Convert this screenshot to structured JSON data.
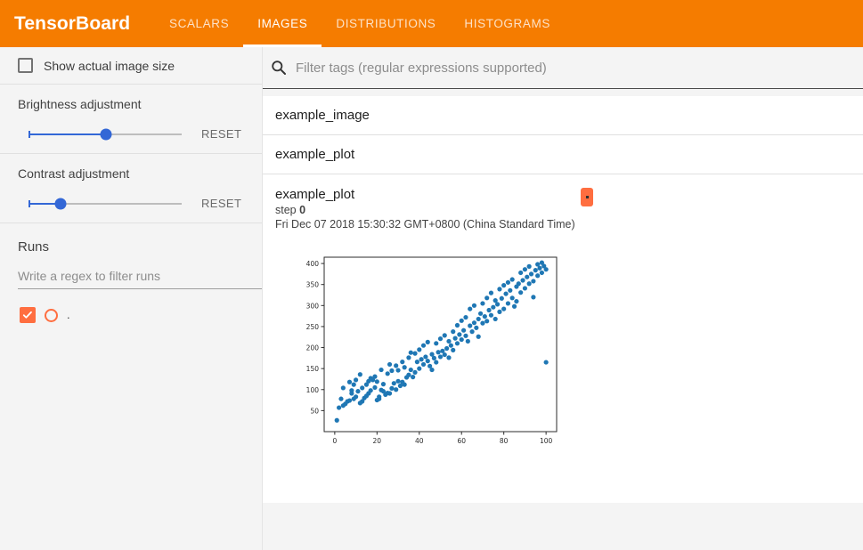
{
  "header": {
    "brand": "TensorBoard",
    "tabs": [
      {
        "label": "SCALARS",
        "active": false
      },
      {
        "label": "IMAGES",
        "active": true
      },
      {
        "label": "DISTRIBUTIONS",
        "active": false
      },
      {
        "label": "HISTOGRAMS",
        "active": false
      }
    ]
  },
  "sidebar": {
    "show_actual_size": {
      "label": "Show actual image size",
      "checked": false
    },
    "brightness": {
      "title": "Brightness adjustment",
      "reset_label": "RESET",
      "value_pct": 50
    },
    "contrast": {
      "title": "Contrast adjustment",
      "reset_label": "RESET",
      "value_pct": 20
    },
    "runs": {
      "title": "Runs",
      "filter_placeholder": "Write a regex to filter runs",
      "filter_value": "",
      "items": [
        {
          "name": ".",
          "selected": true,
          "color": "#ff6e40"
        }
      ]
    }
  },
  "main": {
    "search": {
      "placeholder": "Filter tags (regular expressions supported)",
      "value": "",
      "icon": "search-icon"
    },
    "tags": [
      {
        "label": "example_image"
      },
      {
        "label": "example_plot"
      }
    ],
    "card": {
      "tag": "example_plot",
      "step_label": "step",
      "step_value": "0",
      "timestamp": "Fri Dec 07 2018 15:30:32 GMT+0800 (China Standard Time)",
      "run_badge_name": "."
    }
  },
  "colors": {
    "brand_orange": "#f57c00",
    "run_orange": "#ff6e40",
    "slider_blue": "#3367d6",
    "scatter_blue": "#1f77b4"
  },
  "chart_data": {
    "type": "scatter",
    "title": "",
    "xlabel": "",
    "ylabel": "",
    "xlim": [
      -5,
      105
    ],
    "ylim": [
      0,
      415
    ],
    "xticks": [
      0,
      20,
      40,
      60,
      80,
      100
    ],
    "yticks": [
      50,
      100,
      150,
      200,
      250,
      300,
      350,
      400
    ],
    "grid": false,
    "legend": "none",
    "marker_color": "#1f77b4",
    "marker_size": 5,
    "series": [
      {
        "name": "example_plot",
        "points": [
          [
            1,
            27
          ],
          [
            2,
            57
          ],
          [
            3,
            78
          ],
          [
            4,
            62
          ],
          [
            4,
            104
          ],
          [
            5,
            66
          ],
          [
            6,
            72
          ],
          [
            7,
            74
          ],
          [
            7,
            118
          ],
          [
            8,
            91
          ],
          [
            8,
            98
          ],
          [
            9,
            112
          ],
          [
            9,
            78
          ],
          [
            10,
            83
          ],
          [
            10,
            123
          ],
          [
            11,
            96
          ],
          [
            12,
            68
          ],
          [
            12,
            136
          ],
          [
            13,
            72
          ],
          [
            13,
            104
          ],
          [
            14,
            80
          ],
          [
            15,
            85
          ],
          [
            15,
            112
          ],
          [
            16,
            120
          ],
          [
            16,
            91
          ],
          [
            17,
            127
          ],
          [
            17,
            98
          ],
          [
            18,
            123
          ],
          [
            19,
            105
          ],
          [
            19,
            131
          ],
          [
            20,
            75
          ],
          [
            20,
            119
          ],
          [
            21,
            78
          ],
          [
            21,
            83
          ],
          [
            22,
            99
          ],
          [
            22,
            147
          ],
          [
            23,
            96
          ],
          [
            23,
            113
          ],
          [
            24,
            88
          ],
          [
            25,
            92
          ],
          [
            25,
            138
          ],
          [
            26,
            91
          ],
          [
            26,
            160
          ],
          [
            27,
            103
          ],
          [
            27,
            145
          ],
          [
            28,
            115
          ],
          [
            29,
            100
          ],
          [
            29,
            157
          ],
          [
            30,
            120
          ],
          [
            30,
            146
          ],
          [
            31,
            109
          ],
          [
            32,
            118
          ],
          [
            32,
            166
          ],
          [
            33,
            112
          ],
          [
            33,
            153
          ],
          [
            34,
            129
          ],
          [
            35,
            135
          ],
          [
            35,
            176
          ],
          [
            36,
            147
          ],
          [
            36,
            188
          ],
          [
            37,
            130
          ],
          [
            38,
            141
          ],
          [
            38,
            186
          ],
          [
            39,
            166
          ],
          [
            40,
            150
          ],
          [
            40,
            195
          ],
          [
            41,
            172
          ],
          [
            42,
            160
          ],
          [
            42,
            205
          ],
          [
            43,
            178
          ],
          [
            44,
            168
          ],
          [
            44,
            213
          ],
          [
            45,
            156
          ],
          [
            46,
            184
          ],
          [
            46,
            147
          ],
          [
            47,
            175
          ],
          [
            48,
            165
          ],
          [
            48,
            210
          ],
          [
            49,
            189
          ],
          [
            50,
            178
          ],
          [
            50,
            221
          ],
          [
            51,
            192
          ],
          [
            52,
            183
          ],
          [
            52,
            229
          ],
          [
            53,
            198
          ],
          [
            54,
            215
          ],
          [
            54,
            176
          ],
          [
            55,
            205
          ],
          [
            56,
            194
          ],
          [
            56,
            238
          ],
          [
            57,
            222
          ],
          [
            58,
            210
          ],
          [
            58,
            253
          ],
          [
            59,
            231
          ],
          [
            60,
            219
          ],
          [
            60,
            264
          ],
          [
            61,
            241
          ],
          [
            62,
            228
          ],
          [
            62,
            272
          ],
          [
            63,
            215
          ],
          [
            64,
            252
          ],
          [
            64,
            292
          ],
          [
            65,
            238
          ],
          [
            66,
            259
          ],
          [
            66,
            300
          ],
          [
            67,
            247
          ],
          [
            68,
            268
          ],
          [
            68,
            226
          ],
          [
            69,
            281
          ],
          [
            70,
            258
          ],
          [
            70,
            305
          ],
          [
            71,
            274
          ],
          [
            72,
            263
          ],
          [
            72,
            318
          ],
          [
            73,
            289
          ],
          [
            74,
            277
          ],
          [
            74,
            330
          ],
          [
            75,
            296
          ],
          [
            76,
            268
          ],
          [
            76,
            312
          ],
          [
            77,
            303
          ],
          [
            78,
            285
          ],
          [
            78,
            339
          ],
          [
            79,
            317
          ],
          [
            80,
            292
          ],
          [
            80,
            348
          ],
          [
            81,
            328
          ],
          [
            82,
            305
          ],
          [
            82,
            355
          ],
          [
            83,
            336
          ],
          [
            84,
            318
          ],
          [
            84,
            362
          ],
          [
            85,
            298
          ],
          [
            86,
            345
          ],
          [
            86,
            310
          ],
          [
            87,
            352
          ],
          [
            88,
            331
          ],
          [
            88,
            378
          ],
          [
            89,
            360
          ],
          [
            90,
            341
          ],
          [
            90,
            386
          ],
          [
            91,
            368
          ],
          [
            92,
            352
          ],
          [
            92,
            393
          ],
          [
            93,
            375
          ],
          [
            94,
            358
          ],
          [
            94,
            320
          ],
          [
            95,
            384
          ],
          [
            96,
            371
          ],
          [
            96,
            398
          ],
          [
            97,
            389
          ],
          [
            98,
            378
          ],
          [
            98,
            402
          ],
          [
            99,
            394
          ],
          [
            100,
            386
          ],
          [
            100,
            165
          ]
        ]
      }
    ]
  }
}
